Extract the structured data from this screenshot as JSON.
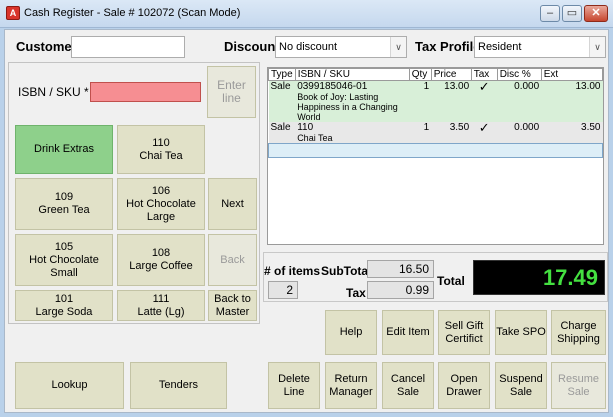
{
  "window": {
    "icon_glyph": "A",
    "title": "Cash Register - Sale # 102072  (Scan Mode)",
    "min_glyph": "–",
    "max_glyph": "▭",
    "close_glyph": "✕"
  },
  "header": {
    "customer_label": "Customer",
    "customer_value": "",
    "discount_label": "Discount",
    "discount_value": "No discount",
    "tax_profile_label": "Tax Profile",
    "tax_profile_value": "Resident",
    "dropdown_glyph": "∨"
  },
  "entry": {
    "isbn_label": "ISBN / SKU *",
    "isbn_value": "",
    "enter_line_label": "Enter line"
  },
  "quick_buttons": {
    "b1": "Drink Extras",
    "b2": "110\nChai Tea",
    "b3": "109\nGreen Tea",
    "b4": "106\nHot Chocolate\nLarge",
    "b5": "Next",
    "b6": "105\nHot Chocolate\nSmall",
    "b7": "108\nLarge Coffee",
    "b8": "Back",
    "b9": "101\nLarge Soda",
    "b10": "111\nLatte (Lg)",
    "b11": "Back to\nMaster"
  },
  "grid": {
    "columns": [
      "Type",
      "ISBN / SKU",
      "Qty",
      "Price",
      "Tax",
      "Disc %",
      "Ext"
    ],
    "rows": [
      {
        "type": "Sale",
        "sku": "0399185046-01",
        "desc": "Book of Joy: Lasting Happiness in a Changing World",
        "qty": "1",
        "price": "13.00",
        "tax": "✓",
        "disc": "0.000",
        "ext": "13.00"
      },
      {
        "type": "Sale",
        "sku": "110",
        "desc": "Chai Tea",
        "qty": "1",
        "price": "3.50",
        "tax": "✓",
        "disc": "0.000",
        "ext": "3.50"
      }
    ]
  },
  "totals": {
    "items_label": "# of items",
    "items_value": "2",
    "subtotal_label": "SubTotal",
    "subtotal_value": "16.50",
    "tax_label": "Tax",
    "tax_value": "0.99",
    "total_label": "Total",
    "total_value": "17.49"
  },
  "actions": {
    "help": "Help",
    "edit_item": "Edit Item",
    "sell_gift": "Sell Gift\nCertifict",
    "take_spo": "Take SPO",
    "charge_shipping": "Charge\nShipping",
    "lookup": "Lookup",
    "tenders": "Tenders",
    "delete_line": "Delete\nLine",
    "return_manager": "Return\nManager",
    "cancel_sale": "Cancel\nSale",
    "open_drawer": "Open\nDrawer",
    "suspend_sale": "Suspend\nSale",
    "resume_sale": "Resume\nSale"
  },
  "colors": {
    "total_fg": "#44e040",
    "isbn_bg": "#f68e92",
    "button_bg": "#e1e1c8",
    "drink_extras_bg": "#8ed08b"
  }
}
